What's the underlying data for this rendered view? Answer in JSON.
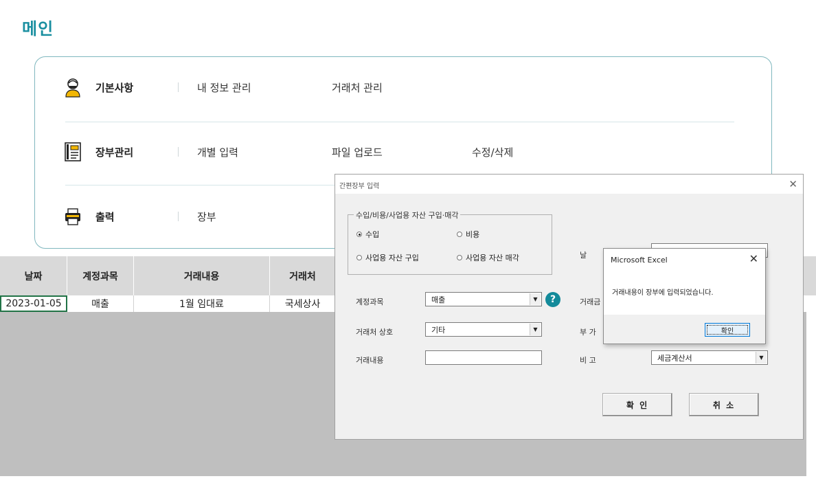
{
  "page": {
    "title": "메인"
  },
  "menu": {
    "basic": {
      "heading": "기본사항",
      "links": [
        "내 정보 관리",
        "거래처 관리"
      ]
    },
    "ledger": {
      "heading": "장부관리",
      "links": [
        "개별 입력",
        "파일 업로드",
        "수정/삭제"
      ]
    },
    "print": {
      "heading": "출력",
      "links": [
        "장부"
      ]
    }
  },
  "sheet": {
    "headers": [
      "날짜",
      "계정과목",
      "거래내용",
      "거래처"
    ],
    "row": [
      "2023-01-05",
      "매출",
      "1월 임대료",
      "국세상사"
    ]
  },
  "form": {
    "title": "간편장부 입력",
    "group_label": "수입/비용/사업용 자산 구입·매각",
    "radios": [
      "수입",
      "비용",
      "사업용 자산 구입",
      "사업용 자산 매각"
    ],
    "selected_radio": "수입",
    "fields": {
      "account_label": "계정과목",
      "account_value": "매출",
      "vendor_label": "거래처 상호",
      "vendor_value": "기타",
      "content_label": "거래내용",
      "content_value": "",
      "date_label": "날",
      "amount_label": "거래금",
      "vat_label": "부 가",
      "note_label": "비    고",
      "note_value": "세금계산서"
    },
    "help_glyph": "?",
    "ok_label": "확 인",
    "cancel_label": "취 소"
  },
  "msgbox": {
    "title": "Microsoft Excel",
    "message": "거래내용이 장부에 입력되었습니다.",
    "ok_label": "확인"
  },
  "colors": {
    "accent": "#1a8fa0",
    "panel_border": "#7fb7be",
    "help": "#138a9a"
  }
}
